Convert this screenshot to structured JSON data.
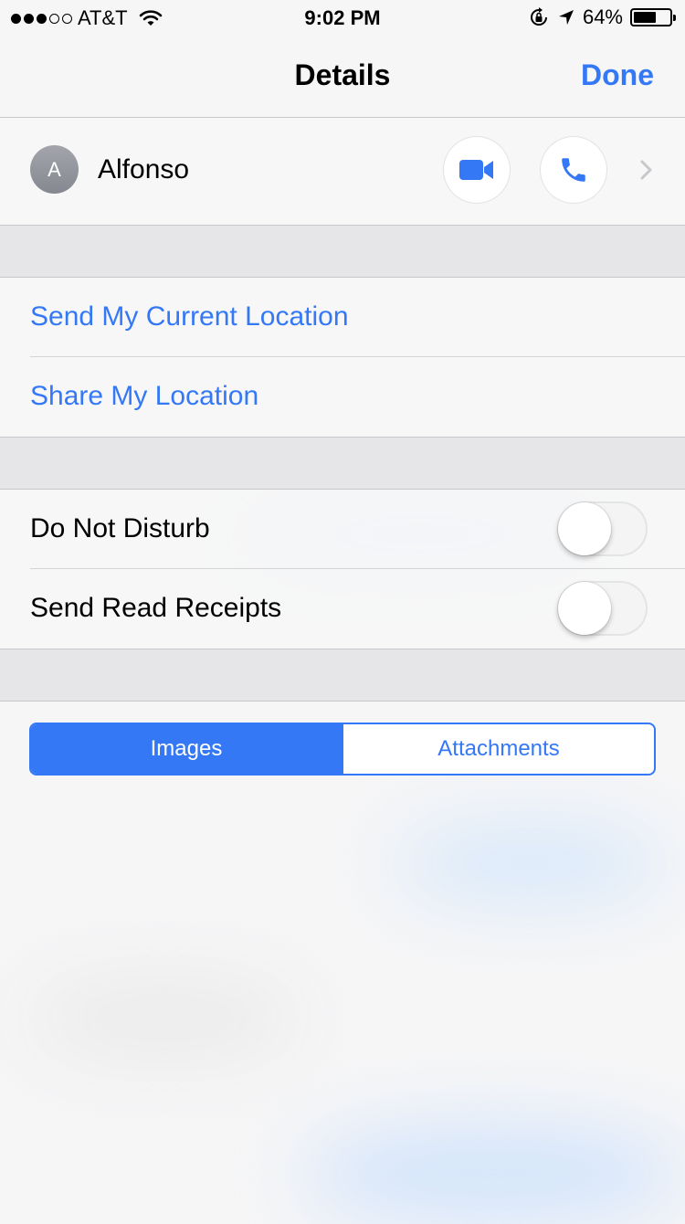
{
  "status_bar": {
    "carrier": "AT&T",
    "time": "9:02 PM",
    "battery_percent": "64%",
    "battery_level": 0.64,
    "signal_bars_filled": 3,
    "signal_bars_total": 5,
    "icons": [
      "wifi-icon",
      "orientation-lock-icon",
      "location-arrow-icon",
      "battery-icon"
    ]
  },
  "nav": {
    "title": "Details",
    "done_label": "Done"
  },
  "contact": {
    "avatar_initial": "A",
    "name": "Alfonso",
    "icons": [
      "video-call-icon",
      "phone-call-icon",
      "chevron-right-icon"
    ]
  },
  "location": {
    "send_current_label": "Send My Current Location",
    "share_label": "Share My Location"
  },
  "settings": {
    "do_not_disturb_label": "Do Not Disturb",
    "do_not_disturb_on": false,
    "read_receipts_label": "Send Read Receipts",
    "read_receipts_on": false
  },
  "segmented": {
    "options": [
      "Images",
      "Attachments"
    ],
    "selected": "Images"
  },
  "colors": {
    "accent": "#3478f6",
    "background": "#f6f6f7",
    "group_gap": "#e6e6e9",
    "separator": "#c8c7cc"
  }
}
